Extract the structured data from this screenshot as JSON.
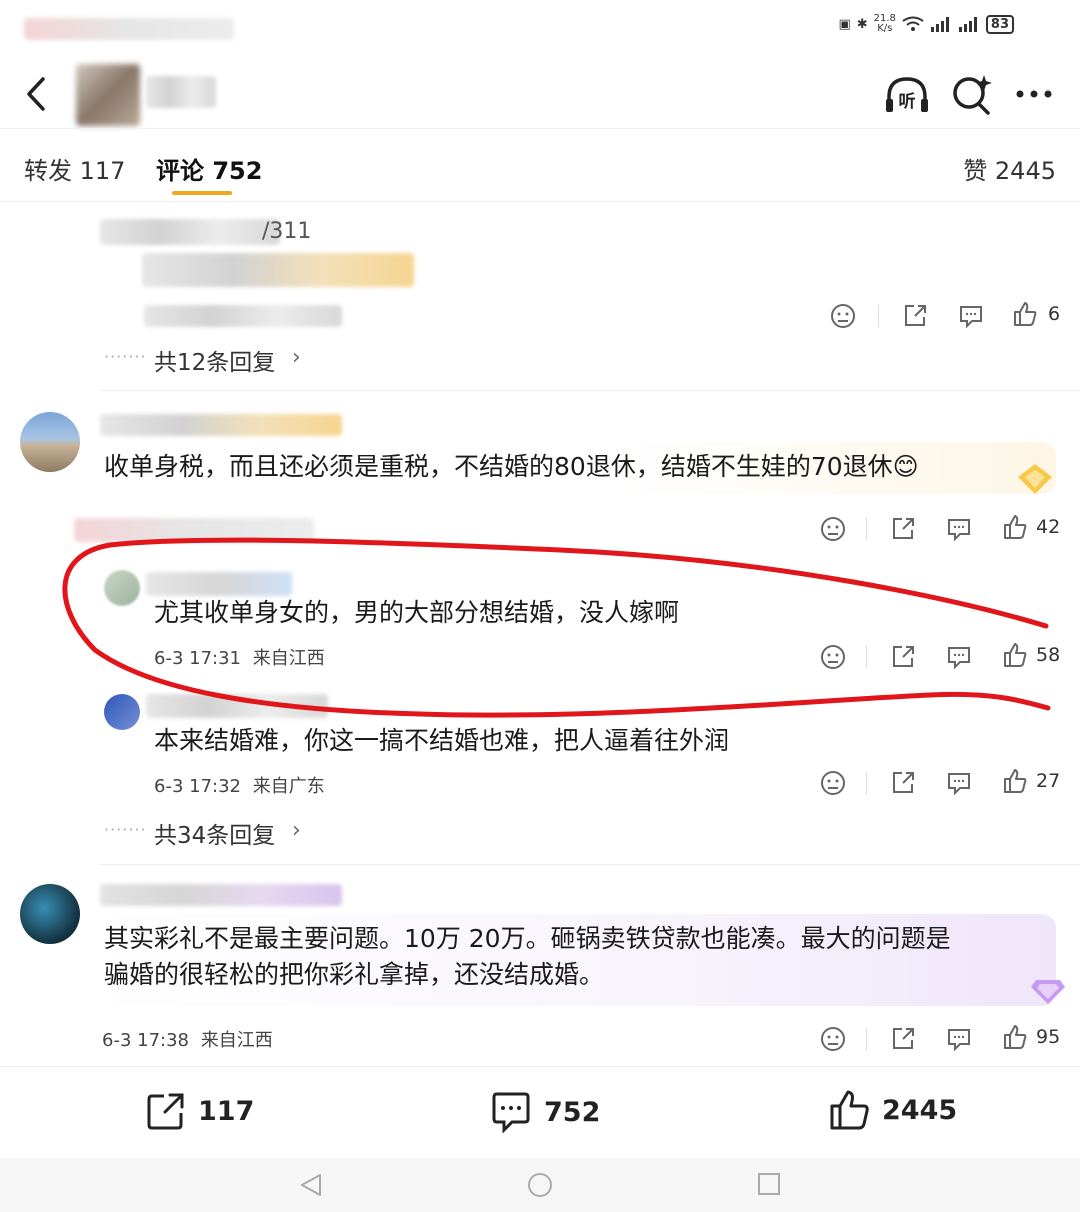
{
  "status_bar": {
    "net_speed": "21.8",
    "net_unit": "K/s",
    "battery": "83"
  },
  "header": {
    "listen_label": "听"
  },
  "tabs": {
    "repost": "转发 117",
    "comments": "评论 752",
    "likes": "赞 2445"
  },
  "comments": [
    {
      "partial_name_suffix": "/311",
      "replies_link": "共12条回复",
      "like_count": "6"
    },
    {
      "text": "收单身税，而且还必须是重税，不结婚的80退休，结婚不生娃的70退休😊",
      "like_count": "42",
      "replies": [
        {
          "text": "尤其收单身女的，男的大部分想结婚，没人嫁啊",
          "time": "6-3 17:31",
          "location": "来自江西",
          "like_count": "58"
        },
        {
          "text": "本来结婚难，你这一搞不结婚也难，把人逼着往外润",
          "time": "6-3 17:32",
          "location": "来自广东",
          "like_count": "27"
        }
      ],
      "replies_link": "共34条回复"
    },
    {
      "text_line1": "其实彩礼不是最主要问题。10万 20万。砸锅卖铁贷款也能凑。最大的问题是",
      "text_line2": "骗婚的很轻松的把你彩礼拿掉，还没结成婚。",
      "time": "6-3 17:38",
      "location": "来自江西",
      "like_count": "95"
    }
  ],
  "bottom_bar": {
    "repost_count": "117",
    "comment_count": "752",
    "like_count": "2445"
  },
  "colors": {
    "accent": "#f0a81c",
    "annotation": "#e0161b"
  }
}
